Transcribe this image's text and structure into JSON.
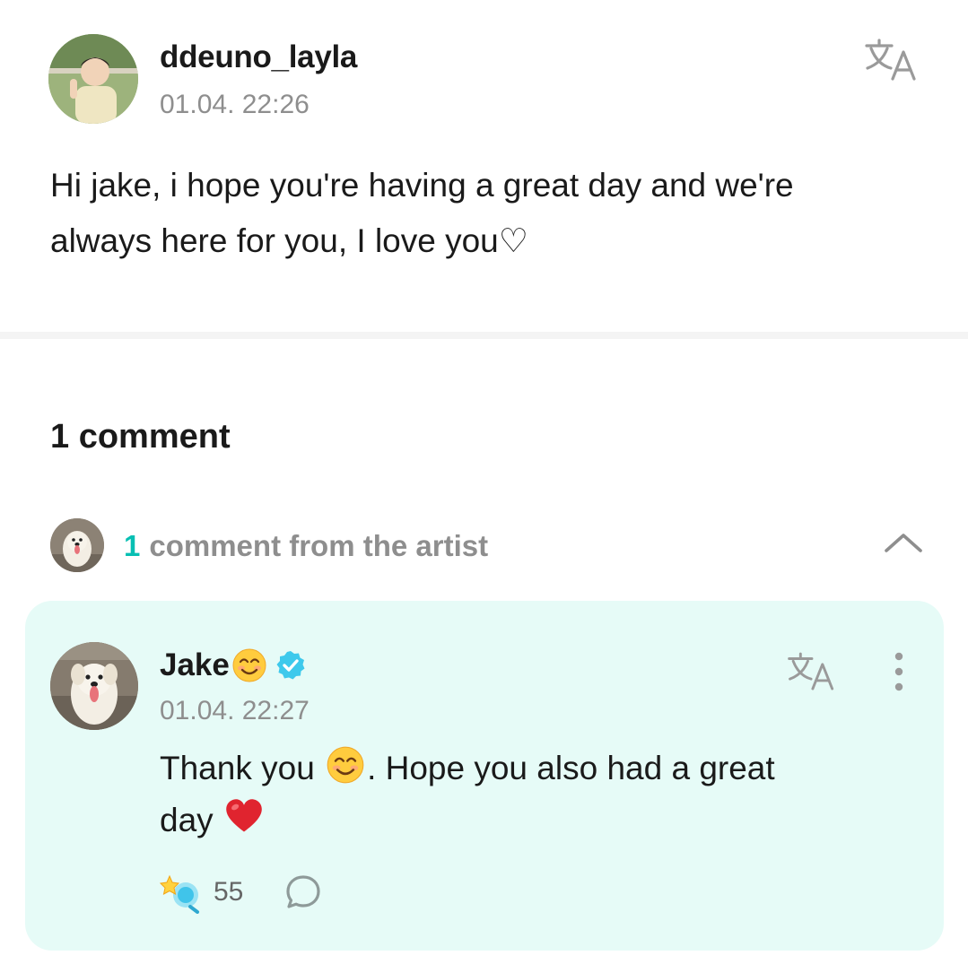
{
  "post": {
    "author": "ddeuno_layla",
    "timestamp": "01.04. 22:26",
    "body_line1": "Hi jake, i hope you're having a great day and we're",
    "body_line2": "always here for you, I love you♡",
    "translate_icon": "translate-icon"
  },
  "comments": {
    "count_label": "1 comment",
    "artist_row": {
      "count": "1",
      "label": "comment from the artist",
      "toggle_icon": "chevron-up-icon"
    }
  },
  "artist_comment": {
    "author": "Jake",
    "author_emoji": "smiling-face-emoji",
    "verified_icon": "verified-badge-icon",
    "timestamp": "01.04. 22:27",
    "body_part1": "Thank you ",
    "body_part2": ". Hope you also had a great",
    "body_part3": "day ",
    "like_count": "55",
    "like_icon": "cheer-icon",
    "reply_icon": "reply-bubble-icon",
    "more_icon": "more-vertical-icon"
  },
  "colors": {
    "accent": "#07bfb3",
    "card_background": "#e6fbf7",
    "muted_text": "#8e8e8e",
    "verified": "#3ec9ec",
    "heart": "#e0242f"
  }
}
